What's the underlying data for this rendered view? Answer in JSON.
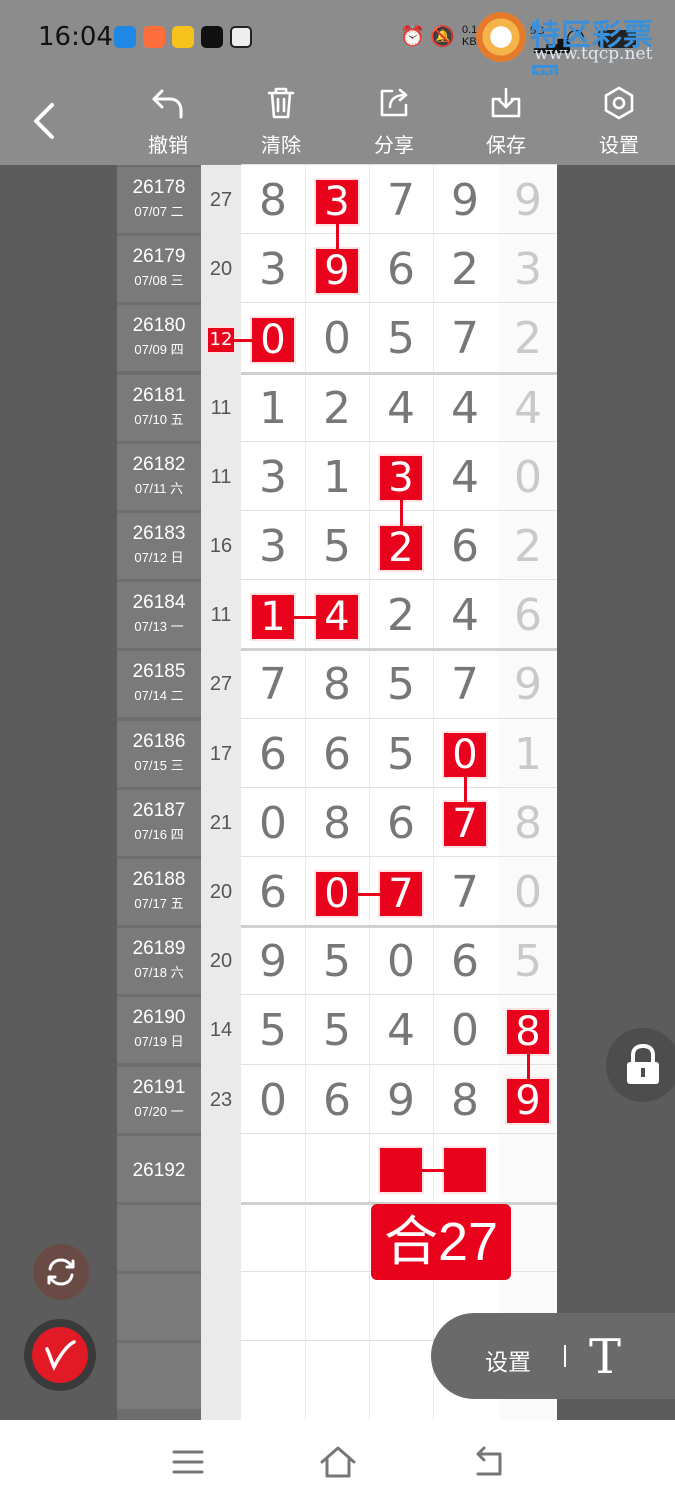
{
  "status_bar": {
    "time": "16:04",
    "net_speed": "0.10",
    "net_unit": "KB/s",
    "signal_5g": "5G",
    "watermark_text": "特区彩票网",
    "watermark_url": "www.tqcp.net"
  },
  "toolbar": {
    "undo": "撤销",
    "clear": "清除",
    "share": "分享",
    "save": "保存",
    "settings": "设置"
  },
  "rows": [
    {
      "id": "26178",
      "date": "07/07 二",
      "sum": "27",
      "digits": [
        "8",
        "3",
        "7",
        "9"
      ],
      "extra": "9"
    },
    {
      "id": "26179",
      "date": "07/08 三",
      "sum": "20",
      "digits": [
        "3",
        "9",
        "6",
        "2"
      ],
      "extra": "3"
    },
    {
      "id": "26180",
      "date": "07/09 四",
      "sum": "12",
      "digits": [
        "0",
        "0",
        "5",
        "7"
      ],
      "extra": "2"
    },
    {
      "id": "26181",
      "date": "07/10 五",
      "sum": "11",
      "digits": [
        "1",
        "2",
        "4",
        "4"
      ],
      "extra": "4"
    },
    {
      "id": "26182",
      "date": "07/11 六",
      "sum": "11",
      "digits": [
        "3",
        "1",
        "3",
        "4"
      ],
      "extra": "0"
    },
    {
      "id": "26183",
      "date": "07/12 日",
      "sum": "16",
      "digits": [
        "3",
        "5",
        "2",
        "6"
      ],
      "extra": "2"
    },
    {
      "id": "26184",
      "date": "07/13 一",
      "sum": "11",
      "digits": [
        "1",
        "4",
        "2",
        "4"
      ],
      "extra": "6"
    },
    {
      "id": "26185",
      "date": "07/14 二",
      "sum": "27",
      "digits": [
        "7",
        "8",
        "5",
        "7"
      ],
      "extra": "9"
    },
    {
      "id": "26186",
      "date": "07/15 三",
      "sum": "17",
      "digits": [
        "6",
        "6",
        "5",
        "0"
      ],
      "extra": "1"
    },
    {
      "id": "26187",
      "date": "07/16 四",
      "sum": "21",
      "digits": [
        "0",
        "8",
        "6",
        "7"
      ],
      "extra": "8"
    },
    {
      "id": "26188",
      "date": "07/17 五",
      "sum": "20",
      "digits": [
        "6",
        "0",
        "7",
        "7"
      ],
      "extra": "0"
    },
    {
      "id": "26189",
      "date": "07/18 六",
      "sum": "20",
      "digits": [
        "9",
        "5",
        "0",
        "6"
      ],
      "extra": "5"
    },
    {
      "id": "26190",
      "date": "07/19 日",
      "sum": "14",
      "digits": [
        "5",
        "5",
        "4",
        "0"
      ],
      "extra": "8"
    },
    {
      "id": "26191",
      "date": "07/20 一",
      "sum": "23",
      "digits": [
        "0",
        "6",
        "9",
        "8"
      ],
      "extra": "9"
    },
    {
      "id": "26192",
      "date": "",
      "sum": "",
      "digits": [
        "",
        "",
        "",
        ""
      ],
      "extra": ""
    }
  ],
  "highlights": [
    {
      "row": 0,
      "col": 1
    },
    {
      "row": 1,
      "col": 1
    },
    {
      "row": 2,
      "col": 0
    },
    {
      "row": 4,
      "col": 2
    },
    {
      "row": 5,
      "col": 2
    },
    {
      "row": 6,
      "col": 0
    },
    {
      "row": 6,
      "col": 1
    },
    {
      "row": 8,
      "col": 3
    },
    {
      "row": 9,
      "col": 3
    },
    {
      "row": 10,
      "col": 1
    },
    {
      "row": 10,
      "col": 2
    },
    {
      "row": 12,
      "col": 4
    },
    {
      "row": 13,
      "col": 4
    }
  ],
  "sum_highlight": {
    "row": 2,
    "value": "12"
  },
  "prediction_label": "合27",
  "controls": {
    "settings_label": "设置",
    "text_tool": "T"
  },
  "colors": {
    "highlight_red": "#e8021c",
    "toolbar_gray": "#8c8c8c",
    "background": "#5c5c5c"
  }
}
